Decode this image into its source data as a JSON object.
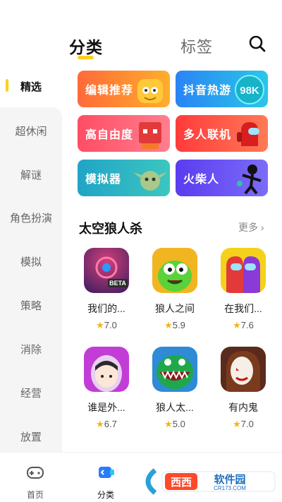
{
  "top_tabs": {
    "category": "分类",
    "tags": "标签"
  },
  "sidebar": {
    "items": [
      {
        "label": "精选"
      },
      {
        "label": "超休闲"
      },
      {
        "label": "解谜"
      },
      {
        "label": "角色扮演"
      },
      {
        "label": "模拟"
      },
      {
        "label": "策略"
      },
      {
        "label": "消除"
      },
      {
        "label": "经营"
      },
      {
        "label": "放置"
      }
    ]
  },
  "categories": [
    {
      "label": "编辑推荐",
      "badge": "oo"
    },
    {
      "label": "抖音热游",
      "badge": "98K"
    },
    {
      "label": "高自由度"
    },
    {
      "label": "多人联机"
    },
    {
      "label": "模拟器"
    },
    {
      "label": "火柴人"
    }
  ],
  "section": {
    "title": "太空狼人杀",
    "more": "更多",
    "games": [
      {
        "name": "我们的...",
        "rating": "7.0",
        "badge": "BETA"
      },
      {
        "name": "狼人之间",
        "rating": "5.9"
      },
      {
        "name": "在我们...",
        "rating": "7.6"
      },
      {
        "name": "谁是外...",
        "rating": "6.7"
      },
      {
        "name": "狼人太...",
        "rating": "5.0"
      },
      {
        "name": "有内鬼",
        "rating": "7.0"
      }
    ]
  },
  "bottom_nav": {
    "items": [
      {
        "label": "首页",
        "icon": "gamepad-icon"
      },
      {
        "label": "分类",
        "icon": "category-icon"
      }
    ]
  },
  "watermark": {
    "text": "西西软件园",
    "sub": "CR173.COM"
  },
  "colors": {
    "accent": "#ffcf1f",
    "star": "#f4b318"
  }
}
